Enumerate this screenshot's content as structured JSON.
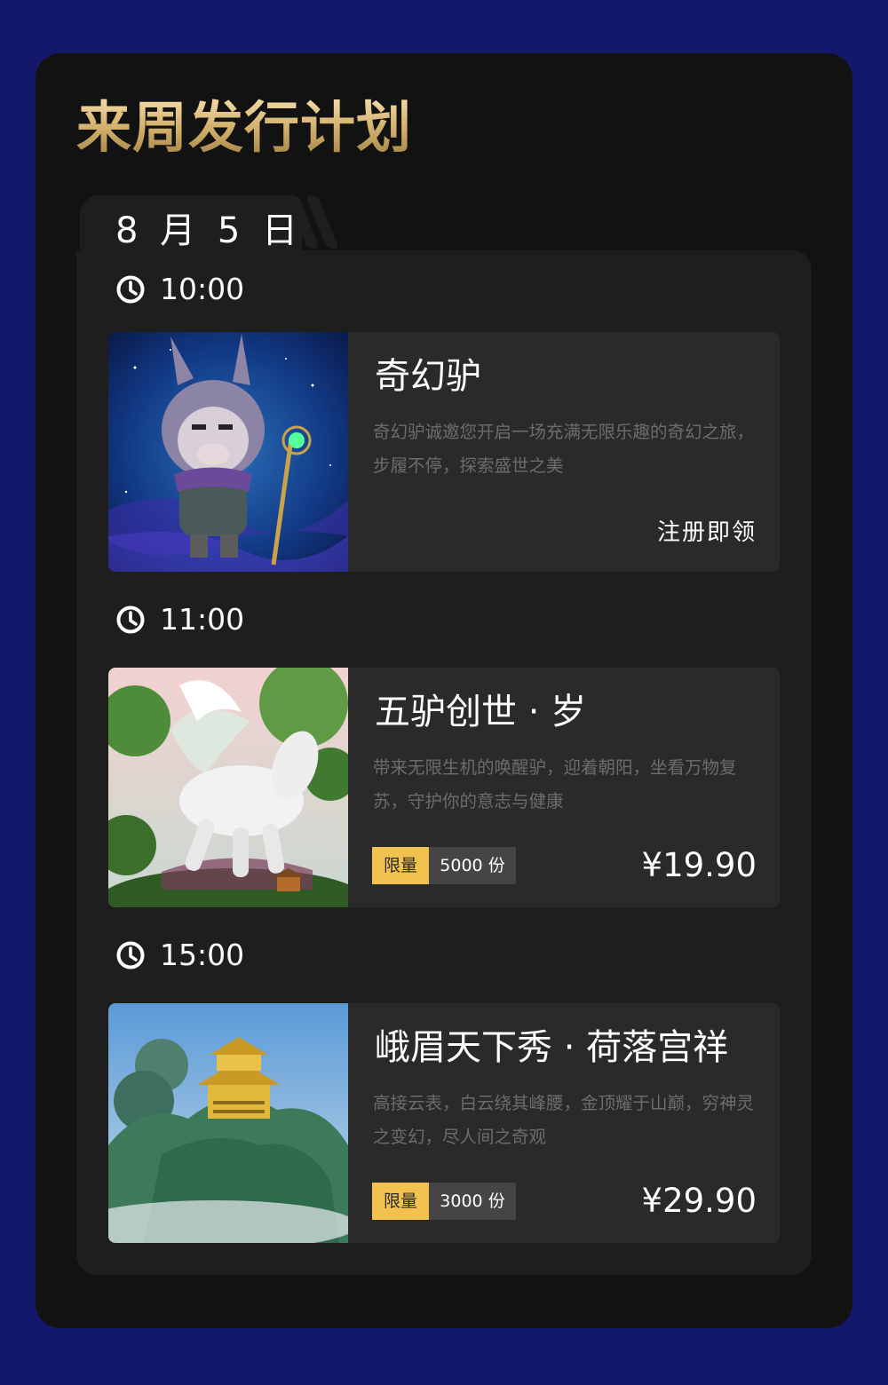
{
  "section_title": "来周发行计划",
  "date_label": "8 月 5 日",
  "schedule": [
    {
      "time": "10:00",
      "product": {
        "title": "奇幻驴",
        "description": "奇幻驴诚邀您开启一场充满无限乐趣的奇幻之旅，步履不停，探索盛世之美",
        "action": "注册即领"
      }
    },
    {
      "time": "11:00",
      "product": {
        "title": "五驴创世 · 岁",
        "description": "带来无限生机的唤醒驴，迎着朝阳，坐看万物复苏，守护你的意志与健康",
        "limit_tag": "限量",
        "limit_count": "5000 份",
        "price": "¥19.90"
      }
    },
    {
      "time": "15:00",
      "product": {
        "title": "峨眉天下秀 · 荷落宫祥",
        "description": "高接云表，白云绕其峰腰，金顶耀于山巅，穷神灵之变幻，尽人间之奇观",
        "limit_tag": "限量",
        "limit_count": "3000 份",
        "price": "¥29.90"
      }
    }
  ],
  "icons": {
    "clock": "clock-icon"
  },
  "colors": {
    "background": "#14186a",
    "card": "#121212",
    "panel": "#1e1e1e",
    "item": "#2a2a2a",
    "title_gold": "#d3b06c",
    "badge_yellow": "#f2c24e"
  }
}
